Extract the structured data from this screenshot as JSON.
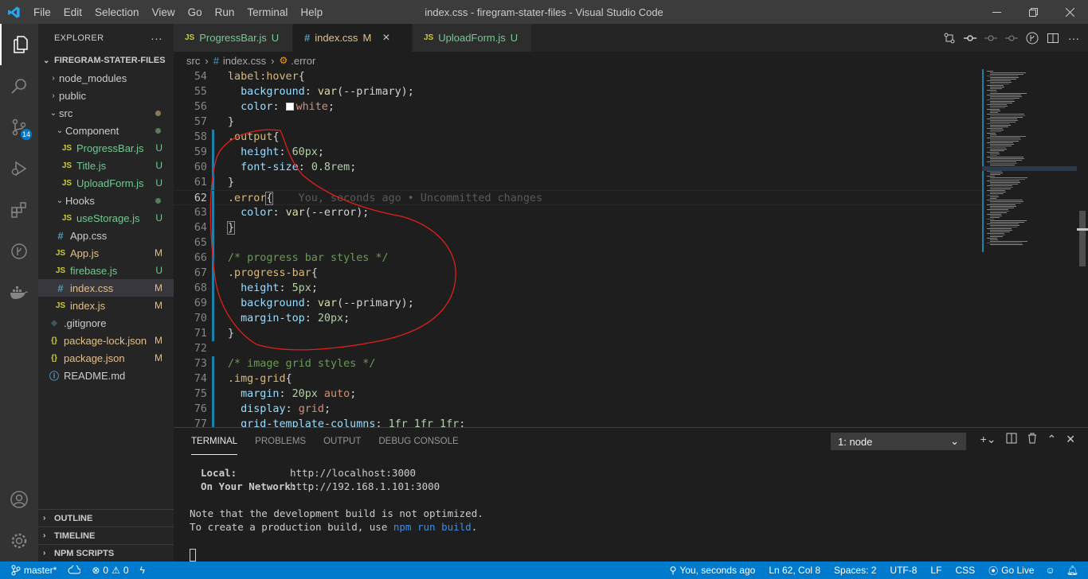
{
  "titlebar": {
    "menu": [
      "File",
      "Edit",
      "Selection",
      "View",
      "Go",
      "Run",
      "Terminal",
      "Help"
    ],
    "title": "index.css - firegram-stater-files - Visual Studio Code"
  },
  "activity": {
    "source_control_badge": "14"
  },
  "explorer": {
    "header": "EXPLORER",
    "more": "···",
    "root": "FIREGRAM-STATER-FILES",
    "items": [
      {
        "label": "node_modules",
        "type": "folder",
        "chev": "›",
        "depth": 1
      },
      {
        "label": "public",
        "type": "folder",
        "chev": "›",
        "depth": 1
      },
      {
        "label": "src",
        "type": "folder",
        "chev": "⌄",
        "depth": 1
      },
      {
        "label": "Component",
        "type": "folder",
        "chev": "⌄",
        "depth": 2
      },
      {
        "label": "ProgressBar.js",
        "type": "js",
        "icon": "JS",
        "status": "U",
        "depth": 3
      },
      {
        "label": "Title.js",
        "type": "js",
        "icon": "JS",
        "status": "U",
        "depth": 3
      },
      {
        "label": "UploadForm.js",
        "type": "js",
        "icon": "JS",
        "status": "U",
        "depth": 3
      },
      {
        "label": "Hooks",
        "type": "folder",
        "chev": "⌄",
        "depth": 2
      },
      {
        "label": "useStorage.js",
        "type": "js",
        "icon": "JS",
        "status": "U",
        "depth": 3
      },
      {
        "label": "App.css",
        "type": "css",
        "icon": "#",
        "status": "",
        "depth": 2
      },
      {
        "label": "App.js",
        "type": "js",
        "icon": "JS",
        "status": "M",
        "depth": 2
      },
      {
        "label": "firebase.js",
        "type": "js",
        "icon": "JS",
        "status": "U",
        "depth": 2
      },
      {
        "label": "index.css",
        "type": "css",
        "icon": "#",
        "status": "M",
        "depth": 2
      },
      {
        "label": "index.js",
        "type": "js",
        "icon": "JS",
        "status": "M",
        "depth": 2
      },
      {
        "label": ".gitignore",
        "type": "git",
        "icon": "◆",
        "status": "",
        "depth": 1
      },
      {
        "label": "package-lock.json",
        "type": "json",
        "icon": "{}",
        "status": "M",
        "depth": 1
      },
      {
        "label": "package.json",
        "type": "json",
        "icon": "{}",
        "status": "M",
        "depth": 1
      },
      {
        "label": "README.md",
        "type": "info",
        "icon": "ⓘ",
        "status": "",
        "depth": 1
      }
    ],
    "sections": [
      "OUTLINE",
      "TIMELINE",
      "NPM SCRIPTS"
    ]
  },
  "tabs": [
    {
      "icon": "JS",
      "label": "ProgressBar.js",
      "status": "U"
    },
    {
      "icon": "#",
      "label": "index.css",
      "status": "M",
      "close": "×"
    },
    {
      "icon": "JS",
      "label": "UploadForm.js",
      "status": "U"
    }
  ],
  "breadcrumb": {
    "folder": "src",
    "file": "index.css",
    "symbol": ".error"
  },
  "editor": {
    "lines": [
      {
        "n": "54",
        "parts": [
          [
            "sel",
            "label:hover"
          ],
          [
            "",
            "{"
          ]
        ]
      },
      {
        "n": "55",
        "parts": [
          [
            "",
            "  "
          ],
          [
            "prop",
            "background"
          ],
          [
            "",
            ": "
          ],
          [
            "fn",
            "var"
          ],
          [
            "",
            "(--primary);"
          ]
        ]
      },
      {
        "n": "56",
        "parts": [
          [
            "",
            "  "
          ],
          [
            "prop",
            "color"
          ],
          [
            "",
            ": "
          ],
          [
            "swatch",
            ""
          ],
          [
            "str",
            "white"
          ],
          [
            "",
            ";"
          ]
        ]
      },
      {
        "n": "57",
        "parts": [
          [
            "",
            "}"
          ]
        ]
      },
      {
        "n": "58",
        "parts": [
          [
            "sel",
            ".output"
          ],
          [
            "",
            "{"
          ]
        ]
      },
      {
        "n": "59",
        "parts": [
          [
            "",
            "  "
          ],
          [
            "prop",
            "height"
          ],
          [
            "",
            ": "
          ],
          [
            "num",
            "60px"
          ],
          [
            "",
            ";"
          ]
        ]
      },
      {
        "n": "60",
        "parts": [
          [
            "",
            "  "
          ],
          [
            "prop",
            "font-size"
          ],
          [
            "",
            ": "
          ],
          [
            "num",
            "0.8rem"
          ],
          [
            "",
            ";"
          ]
        ]
      },
      {
        "n": "61",
        "parts": [
          [
            "",
            "}"
          ]
        ]
      },
      {
        "n": "62",
        "parts": [
          [
            "sel",
            ".error"
          ],
          [
            "box",
            "{"
          ],
          [
            "blame",
            "    You, seconds ago • Uncommitted changes"
          ]
        ]
      },
      {
        "n": "63",
        "parts": [
          [
            "",
            "  "
          ],
          [
            "prop",
            "color"
          ],
          [
            "",
            ": "
          ],
          [
            "fn",
            "var"
          ],
          [
            "",
            "(--error);"
          ]
        ]
      },
      {
        "n": "64",
        "parts": [
          [
            "box",
            "}"
          ]
        ]
      },
      {
        "n": "65",
        "parts": []
      },
      {
        "n": "66",
        "parts": [
          [
            "cmt",
            "/* progress bar styles */"
          ]
        ]
      },
      {
        "n": "67",
        "parts": [
          [
            "sel",
            ".progress-bar"
          ],
          [
            "",
            "{"
          ]
        ]
      },
      {
        "n": "68",
        "parts": [
          [
            "",
            "  "
          ],
          [
            "prop",
            "height"
          ],
          [
            "",
            ": "
          ],
          [
            "num",
            "5px"
          ],
          [
            "",
            ";"
          ]
        ]
      },
      {
        "n": "69",
        "parts": [
          [
            "",
            "  "
          ],
          [
            "prop",
            "background"
          ],
          [
            "",
            ": "
          ],
          [
            "fn",
            "var"
          ],
          [
            "",
            "(--primary);"
          ]
        ]
      },
      {
        "n": "70",
        "parts": [
          [
            "",
            "  "
          ],
          [
            "prop",
            "margin-top"
          ],
          [
            "",
            ": "
          ],
          [
            "num",
            "20px"
          ],
          [
            "",
            ";"
          ]
        ]
      },
      {
        "n": "71",
        "parts": [
          [
            "",
            "}"
          ]
        ]
      },
      {
        "n": "72",
        "parts": []
      },
      {
        "n": "73",
        "parts": [
          [
            "cmt",
            "/* image grid styles */"
          ]
        ]
      },
      {
        "n": "74",
        "parts": [
          [
            "sel",
            ".img-grid"
          ],
          [
            "",
            "{"
          ]
        ]
      },
      {
        "n": "75",
        "parts": [
          [
            "",
            "  "
          ],
          [
            "prop",
            "margin"
          ],
          [
            "",
            ": "
          ],
          [
            "num",
            "20px"
          ],
          [
            "str",
            " auto"
          ],
          [
            "",
            ";"
          ]
        ]
      },
      {
        "n": "76",
        "parts": [
          [
            "",
            "  "
          ],
          [
            "prop",
            "display"
          ],
          [
            "",
            ": "
          ],
          [
            "str",
            "grid"
          ],
          [
            "",
            ";"
          ]
        ]
      },
      {
        "n": "77",
        "parts": [
          [
            "",
            "  "
          ],
          [
            "prop",
            "grid-template-columns"
          ],
          [
            "",
            ": "
          ],
          [
            "num",
            "1fr 1fr 1fr"
          ],
          [
            "",
            ";"
          ]
        ]
      }
    ],
    "current_line": "62"
  },
  "panel": {
    "tabs": [
      "TERMINAL",
      "PROBLEMS",
      "OUTPUT",
      "DEBUG CONSOLE"
    ],
    "terminal_select": "1: node",
    "terminal": {
      "local_label": "Local:",
      "local_url": "http://localhost:3000",
      "net_label": "On Your Network:",
      "net_url": "http://192.168.1.101:3000",
      "note1": "Note that the development build is not optimized.",
      "note2_a": "To create a production build, use ",
      "note2_cmd": "npm run build",
      "note2_b": "."
    }
  },
  "status": {
    "branch": "master*",
    "errors": "0",
    "warnings": "0",
    "blame": "You, seconds ago",
    "position": "Ln 62, Col 8",
    "spaces": "Spaces: 2",
    "encoding": "UTF-8",
    "eol": "LF",
    "language": "CSS",
    "golive": "Go Live"
  },
  "colors": {
    "accent": "#007acc",
    "annotation": "#e0201a"
  }
}
